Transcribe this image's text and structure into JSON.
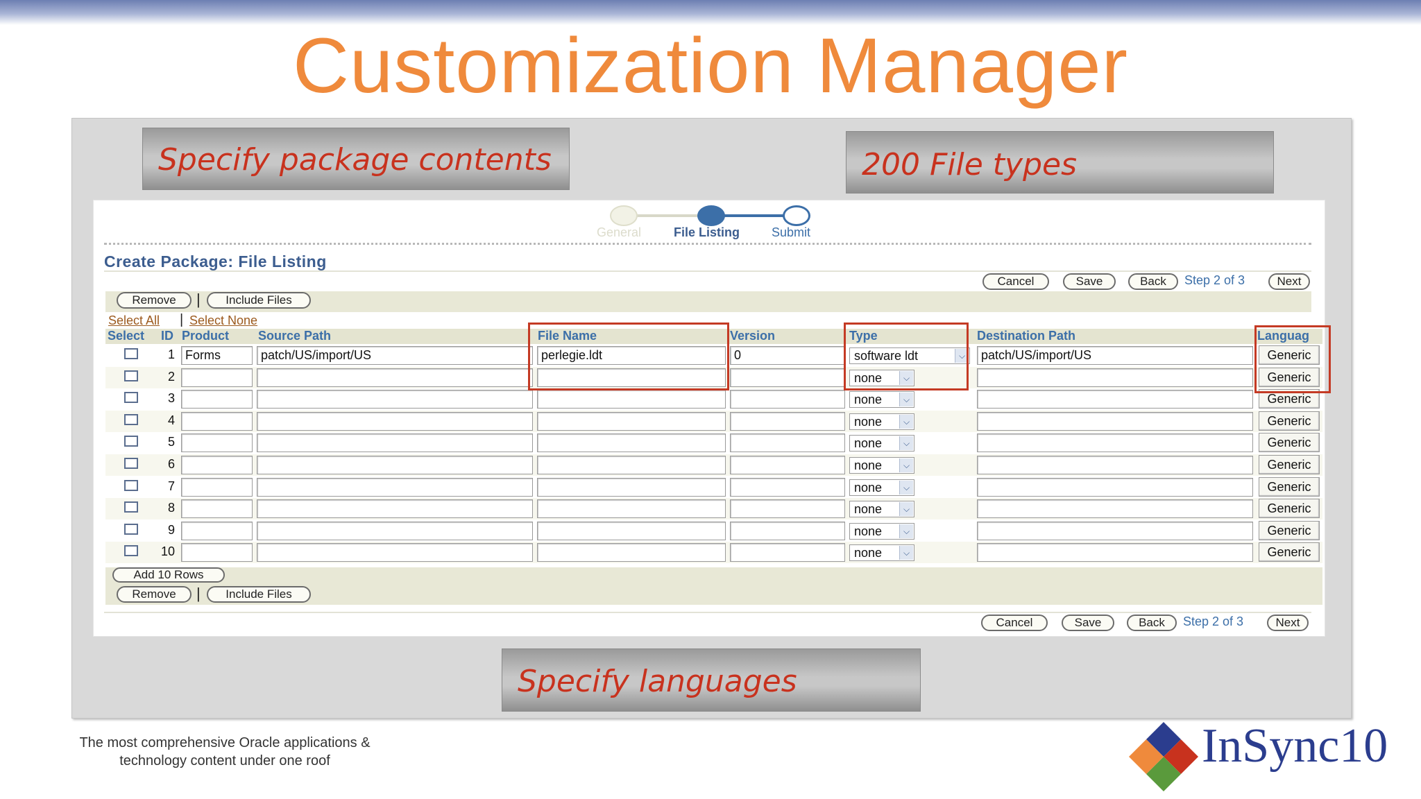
{
  "slide": {
    "title": "Customization Manager",
    "callout_package": "Specify package contents",
    "callout_types": "200 File types",
    "callout_languages": "Specify languages",
    "footer_line1": "The most comprehensive Oracle applications &",
    "footer_line2": "technology content under one roof",
    "brand": "InSync10"
  },
  "train": {
    "steps": [
      "General",
      "File Listing",
      "Submit"
    ],
    "current": 1
  },
  "page": {
    "header": "Create Package: File Listing"
  },
  "nav": {
    "cancel": "Cancel",
    "save": "Save",
    "back": "Back",
    "step": "Step 2 of 3",
    "next": "Next"
  },
  "actions": {
    "remove": "Remove",
    "include": "Include Files",
    "select_all": "Select All",
    "select_none": "Select None",
    "add_rows": "Add 10 Rows"
  },
  "table": {
    "columns": [
      "Select",
      "ID",
      "Product",
      "Source Path",
      "File Name",
      "Version",
      "Type",
      "Destination Path",
      "Languag"
    ],
    "rows": [
      {
        "id": "1",
        "product": "Forms",
        "source": "patch/US/import/US",
        "file": "perlegie.ldt",
        "version": "0",
        "type": "software ldt",
        "dest": "patch/US/import/US",
        "lang": "Generic"
      },
      {
        "id": "2",
        "product": "",
        "source": "",
        "file": "",
        "version": "",
        "type": "none",
        "dest": "",
        "lang": "Generic"
      },
      {
        "id": "3",
        "product": "",
        "source": "",
        "file": "",
        "version": "",
        "type": "none",
        "dest": "",
        "lang": "Generic"
      },
      {
        "id": "4",
        "product": "",
        "source": "",
        "file": "",
        "version": "",
        "type": "none",
        "dest": "",
        "lang": "Generic"
      },
      {
        "id": "5",
        "product": "",
        "source": "",
        "file": "",
        "version": "",
        "type": "none",
        "dest": "",
        "lang": "Generic"
      },
      {
        "id": "6",
        "product": "",
        "source": "",
        "file": "",
        "version": "",
        "type": "none",
        "dest": "",
        "lang": "Generic"
      },
      {
        "id": "7",
        "product": "",
        "source": "",
        "file": "",
        "version": "",
        "type": "none",
        "dest": "",
        "lang": "Generic"
      },
      {
        "id": "8",
        "product": "",
        "source": "",
        "file": "",
        "version": "",
        "type": "none",
        "dest": "",
        "lang": "Generic"
      },
      {
        "id": "9",
        "product": "",
        "source": "",
        "file": "",
        "version": "",
        "type": "none",
        "dest": "",
        "lang": "Generic"
      },
      {
        "id": "10",
        "product": "",
        "source": "",
        "file": "",
        "version": "",
        "type": "none",
        "dest": "",
        "lang": "Generic"
      }
    ]
  },
  "colors": {
    "title": "#ef8a3c",
    "callout_text": "#c8321e",
    "highlight_box": "#c43a24",
    "oracle_blue": "#3c6fa8"
  }
}
